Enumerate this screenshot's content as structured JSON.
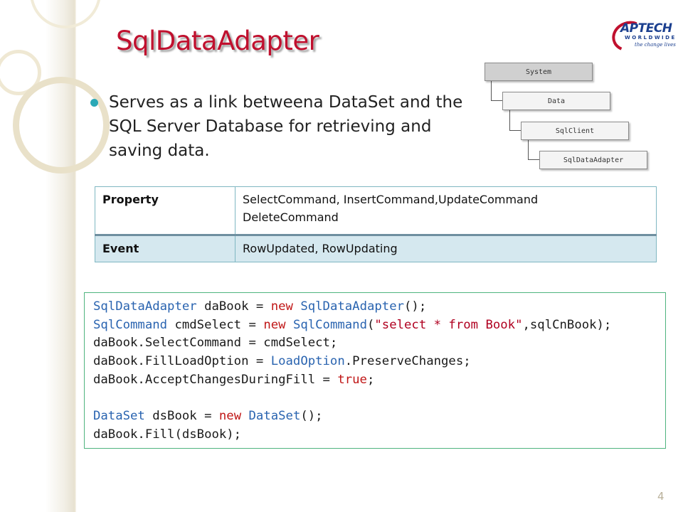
{
  "slide": {
    "title": "SqlDataAdapter",
    "bullet": "Serves as a link betweena DataSet and the SQL Server Database for retrieving and saving data.",
    "page_number": "4"
  },
  "logo": {
    "name": "APTECH",
    "sub": "WORLDWIDE",
    "tagline": "the change lives",
    "brand_color": "#1b3f8f",
    "accent_color": "#c0102e"
  },
  "hierarchy": [
    "System",
    "Data",
    "SqlClient",
    "SqlDataAdapter"
  ],
  "table": {
    "rows": [
      {
        "key": "Property",
        "value_line1": "SelectCommand, InsertCommand,UpdateCommand",
        "value_line2": "DeleteCommand"
      },
      {
        "key": "Event",
        "value_line1": "RowUpdated, RowUpdating",
        "value_line2": ""
      }
    ]
  },
  "code": {
    "lines": [
      [
        {
          "t": "type",
          "s": "SqlDataAdapter"
        },
        {
          "t": "plain",
          "s": " daBook = "
        },
        {
          "t": "kw",
          "s": "new"
        },
        {
          "t": "plain",
          "s": " "
        },
        {
          "t": "type",
          "s": "SqlDataAdapter"
        },
        {
          "t": "plain",
          "s": "();"
        }
      ],
      [
        {
          "t": "type",
          "s": "SqlCommand"
        },
        {
          "t": "plain",
          "s": " cmdSelect = "
        },
        {
          "t": "kw",
          "s": "new"
        },
        {
          "t": "plain",
          "s": " "
        },
        {
          "t": "type",
          "s": "SqlCommand"
        },
        {
          "t": "plain",
          "s": "("
        },
        {
          "t": "str",
          "s": "\"select * from Book\""
        },
        {
          "t": "plain",
          "s": ",sqlCnBook);"
        }
      ],
      [
        {
          "t": "plain",
          "s": "daBook.SelectCommand = cmdSelect;"
        }
      ],
      [
        {
          "t": "plain",
          "s": "daBook.FillLoadOption = "
        },
        {
          "t": "type",
          "s": "LoadOption"
        },
        {
          "t": "plain",
          "s": ".PreserveChanges;"
        }
      ],
      [
        {
          "t": "plain",
          "s": "daBook.AcceptChangesDuringFill = "
        },
        {
          "t": "kw",
          "s": "true"
        },
        {
          "t": "plain",
          "s": ";"
        }
      ],
      [
        {
          "t": "plain",
          "s": ""
        }
      ],
      [
        {
          "t": "type",
          "s": "DataSet"
        },
        {
          "t": "plain",
          "s": " dsBook = "
        },
        {
          "t": "kw",
          "s": "new"
        },
        {
          "t": "plain",
          "s": " "
        },
        {
          "t": "type",
          "s": "DataSet"
        },
        {
          "t": "plain",
          "s": "();"
        }
      ],
      [
        {
          "t": "plain",
          "s": "daBook.Fill(dsBook);"
        }
      ]
    ],
    "colors": {
      "type": "#2a64b0",
      "kw": "#c01717",
      "str": "#b00020"
    }
  }
}
